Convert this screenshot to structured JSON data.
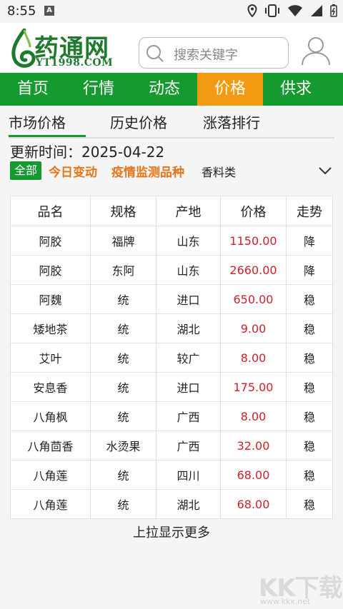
{
  "status_bar": {
    "time": "8:55",
    "sim_label": "A"
  },
  "header": {
    "logo_cn": "药通网",
    "logo_en": "YT1998.COM",
    "search_placeholder": "搜索关键字"
  },
  "nav": [
    "首页",
    "行情",
    "动态",
    "价格",
    "供求"
  ],
  "nav_active": 3,
  "subtabs": [
    "市场价格",
    "历史价格",
    "涨落排行"
  ],
  "update_label": "更新时间：",
  "update_date": "2025-04-22",
  "filters": {
    "all": "全部",
    "today": "今日变动",
    "epidemic": "疫情监测品种",
    "spice": "香料类"
  },
  "table": {
    "headers": [
      "品名",
      "规格",
      "产地",
      "价格",
      "走势"
    ],
    "rows": [
      [
        "阿胶",
        "福牌",
        "山东",
        "1150.00",
        "降"
      ],
      [
        "阿胶",
        "东阿",
        "山东",
        "2660.00",
        "降"
      ],
      [
        "阿魏",
        "统",
        "进口",
        "650.00",
        "稳"
      ],
      [
        "矮地茶",
        "统",
        "湖北",
        "9.00",
        "稳"
      ],
      [
        "艾叶",
        "统",
        "较广",
        "8.00",
        "稳"
      ],
      [
        "安息香",
        "统",
        "进口",
        "175.00",
        "稳"
      ],
      [
        "八角枫",
        "统",
        "广西",
        "8.00",
        "稳"
      ],
      [
        "八角茴香",
        "水烫果",
        "广西",
        "32.00",
        "稳"
      ],
      [
        "八角莲",
        "统",
        "四川",
        "68.00",
        "稳"
      ],
      [
        "八角莲",
        "统",
        "湖北",
        "68.00",
        "稳"
      ]
    ]
  },
  "more_text": "上拉显示更多",
  "watermark": {
    "brand": "KK下载",
    "url": "www.kkx.net"
  },
  "colors": {
    "green": "#159a2f",
    "orange": "#f39a12",
    "price_red": "#d0202a",
    "filter_orange": "#e8741a"
  }
}
